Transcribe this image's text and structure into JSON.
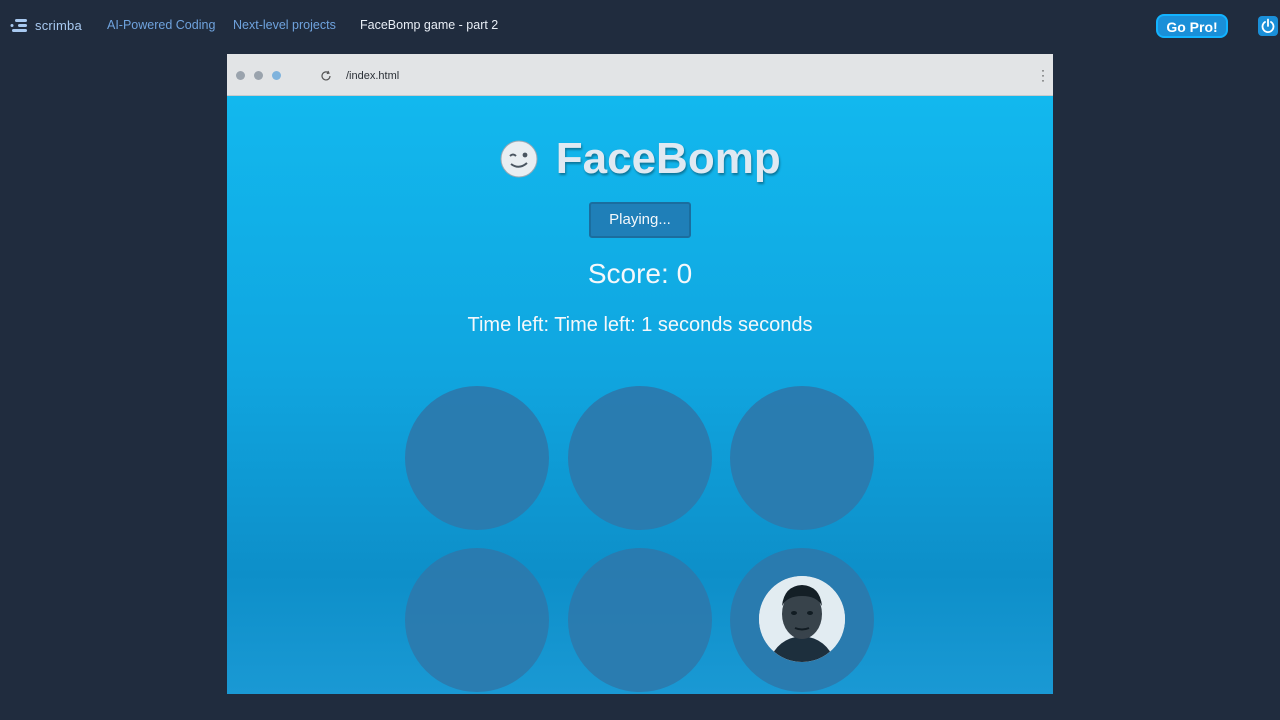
{
  "topbar": {
    "brand": "scrimba",
    "breadcrumbs": [
      "AI-Powered Coding",
      "Next-level projects",
      "FaceBomp game - part 2"
    ],
    "gopro_label": "Go Pro!",
    "power_icon": "power-icon"
  },
  "browser": {
    "url": "/index.html",
    "reload_icon": "reload-icon",
    "menu_icon": "more-vertical-icon"
  },
  "game": {
    "title": "FaceBomp",
    "title_emoji": "winking-face-emoji",
    "status_label": "Playing...",
    "score_text": "Score: 0",
    "timer_text": "Time left: Time left: 1 seconds seconds",
    "holes_count": 6,
    "active_hole": 6
  },
  "colors": {
    "background": "#202c3e",
    "accent": "#1a8fd8",
    "game_top": "#12b8ee",
    "hole": "#2b7aae"
  }
}
